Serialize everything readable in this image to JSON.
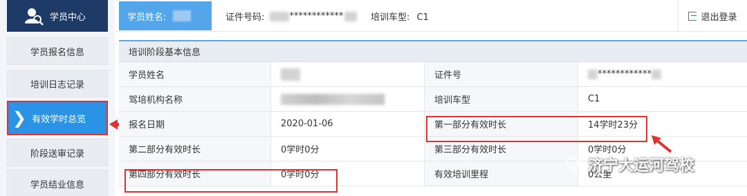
{
  "sidebar": {
    "header_label": "学员中心",
    "items": [
      {
        "label": "学员报名信息"
      },
      {
        "label": "培训日志记录"
      },
      {
        "label": "有效学时总览"
      },
      {
        "label": "阶段送审记录"
      },
      {
        "label": "学员结业信息"
      }
    ]
  },
  "topbar": {
    "student_name_label": "学员姓名:",
    "id_label": "证件号码:",
    "id_value": "************",
    "car_type_label": "培训车型:",
    "car_type_value": "C1",
    "logout_label": "退出登录"
  },
  "table": {
    "title": "培训阶段基本信息",
    "rows": [
      {
        "l1": "学员姓名",
        "v1": "",
        "l2": "证件号",
        "v2": "************"
      },
      {
        "l1": "驾培机构名称",
        "v1": "",
        "l2": "培训车型",
        "v2": "C1"
      },
      {
        "l1": "报名日期",
        "v1": "2020-01-06",
        "l2": "第一部分有效时长",
        "v2": "14学时23分"
      },
      {
        "l1": "第二部分有效时长",
        "v1": "0学时0分",
        "l2": "第三部分有效时长",
        "v2": "0学时0分"
      },
      {
        "l1": "第四部分有效时长",
        "v1": "0学时0分",
        "l2": "有效培训里程",
        "v2": "0公里"
      }
    ]
  },
  "watermark": "济宁大运河驾校",
  "colors": {
    "sidebar_header": "#1d3b66",
    "active_item": "#2b93e6",
    "highlight_red": "#e0312f",
    "accent_blue": "#53a6ea"
  }
}
